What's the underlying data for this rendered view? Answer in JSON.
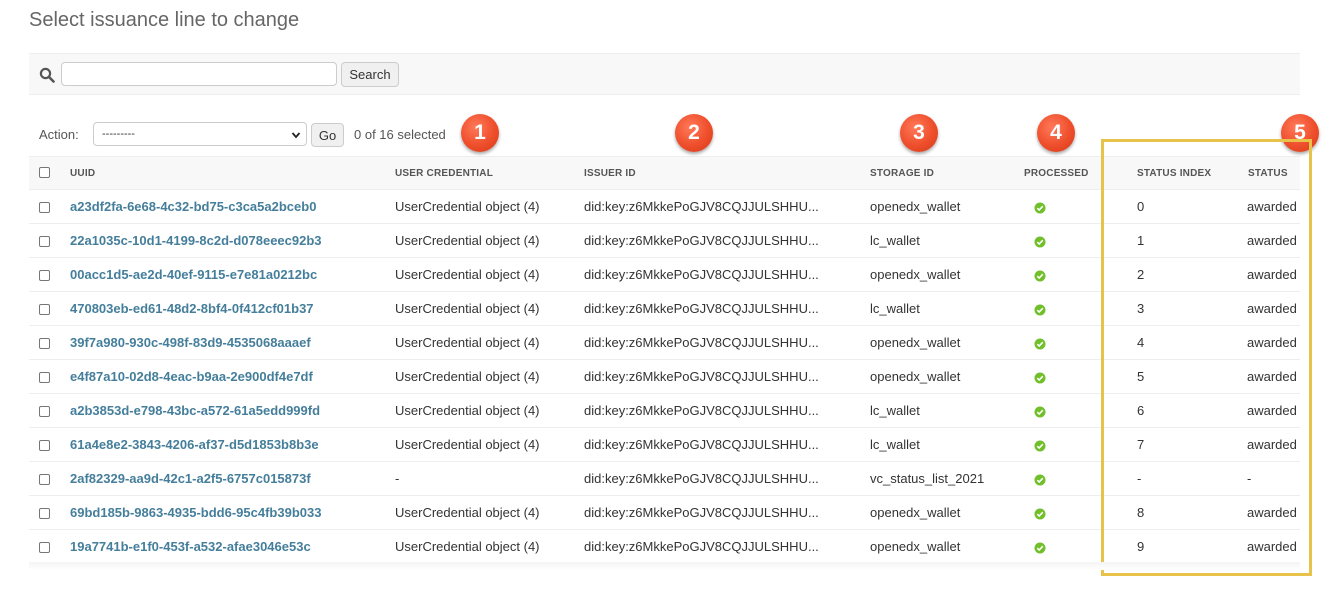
{
  "page": {
    "title": "Select issuance line to change"
  },
  "search": {
    "placeholder": "",
    "value": "",
    "button_label": "Search"
  },
  "actions": {
    "label": "Action:",
    "selected": "---------",
    "go_label": "Go",
    "selected_count": "0 of 16 selected"
  },
  "table": {
    "columns": [
      "UUID",
      "USER CREDENTIAL",
      "ISSUER ID",
      "STORAGE ID",
      "PROCESSED",
      "STATUS INDEX",
      "STATUS"
    ],
    "rows": [
      {
        "uuid": "a23df2fa-6e68-4c32-bd75-c3ca5a2bceb0",
        "user_credential": "UserCredential object (4)",
        "issuer_id": "did:key:z6MkkePoGJV8CQJJULSHHU...",
        "storage_id": "openedx_wallet",
        "status_index": "0",
        "status": "awarded"
      },
      {
        "uuid": "22a1035c-10d1-4199-8c2d-d078eeec92b3",
        "user_credential": "UserCredential object (4)",
        "issuer_id": "did:key:z6MkkePoGJV8CQJJULSHHU...",
        "storage_id": "lc_wallet",
        "status_index": "1",
        "status": "awarded"
      },
      {
        "uuid": "00acc1d5-ae2d-40ef-9115-e7e81a0212bc",
        "user_credential": "UserCredential object (4)",
        "issuer_id": "did:key:z6MkkePoGJV8CQJJULSHHU...",
        "storage_id": "openedx_wallet",
        "status_index": "2",
        "status": "awarded"
      },
      {
        "uuid": "470803eb-ed61-48d2-8bf4-0f412cf01b37",
        "user_credential": "UserCredential object (4)",
        "issuer_id": "did:key:z6MkkePoGJV8CQJJULSHHU...",
        "storage_id": "lc_wallet",
        "status_index": "3",
        "status": "awarded"
      },
      {
        "uuid": "39f7a980-930c-498f-83d9-4535068aaaef",
        "user_credential": "UserCredential object (4)",
        "issuer_id": "did:key:z6MkkePoGJV8CQJJULSHHU...",
        "storage_id": "openedx_wallet",
        "status_index": "4",
        "status": "awarded"
      },
      {
        "uuid": "e4f87a10-02d8-4eac-b9aa-2e900df4e7df",
        "user_credential": "UserCredential object (4)",
        "issuer_id": "did:key:z6MkkePoGJV8CQJJULSHHU...",
        "storage_id": "openedx_wallet",
        "status_index": "5",
        "status": "awarded"
      },
      {
        "uuid": "a2b3853d-e798-43bc-a572-61a5edd999fd",
        "user_credential": "UserCredential object (4)",
        "issuer_id": "did:key:z6MkkePoGJV8CQJJULSHHU...",
        "storage_id": "lc_wallet",
        "status_index": "6",
        "status": "awarded"
      },
      {
        "uuid": "61a4e8e2-3843-4206-af37-d5d1853b8b3e",
        "user_credential": "UserCredential object (4)",
        "issuer_id": "did:key:z6MkkePoGJV8CQJJULSHHU...",
        "storage_id": "lc_wallet",
        "status_index": "7",
        "status": "awarded"
      },
      {
        "uuid": "2af82329-aa9d-42c1-a2f5-6757c015873f",
        "user_credential": "-",
        "issuer_id": "did:key:z6MkkePoGJV8CQJJULSHHU...",
        "storage_id": "vc_status_list_2021",
        "status_index": "-",
        "status": "-"
      },
      {
        "uuid": "69bd185b-9863-4935-bdd6-95c4fb39b033",
        "user_credential": "UserCredential object (4)",
        "issuer_id": "did:key:z6MkkePoGJV8CQJJULSHHU...",
        "storage_id": "openedx_wallet",
        "status_index": "8",
        "status": "awarded"
      },
      {
        "uuid": "19a7741b-e1f0-453f-a532-afae3046e53c",
        "user_credential": "UserCredential object (4)",
        "issuer_id": "did:key:z6MkkePoGJV8CQJJULSHHU...",
        "storage_id": "openedx_wallet",
        "status_index": "9",
        "status": "awarded"
      }
    ]
  },
  "annotations": {
    "badges": [
      "1",
      "2",
      "3",
      "4",
      "5"
    ],
    "badge_color": "#ee4e2b",
    "highlight_color": "#e7c34b"
  },
  "colors": {
    "link": "#447e9b",
    "processed_check": "#70bf2b",
    "header_bg": "#f8f8f8"
  },
  "icons": {
    "search": "search-icon",
    "processed": "check-circle-icon",
    "select": "chevron-down-icon"
  }
}
